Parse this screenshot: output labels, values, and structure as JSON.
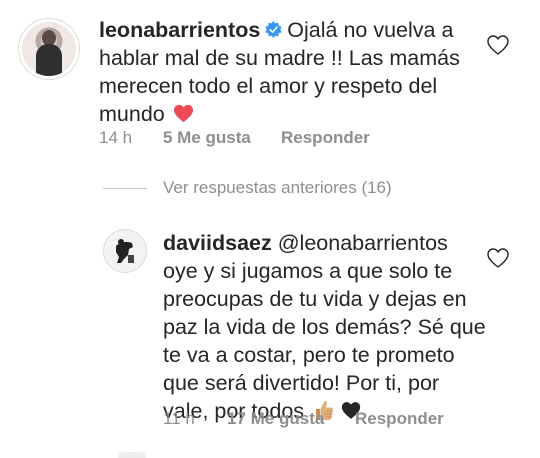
{
  "main_comment": {
    "username": "leonabarrientos",
    "text_line1": "Ojalá no vuelva a",
    "text_line2": "hablar mal de su madre !! Las mamás",
    "text_line3": "merecen todo el amor y respeto del",
    "text_line4": "mundo",
    "emoji": "❤️",
    "time": "14 h",
    "likes": "5 Me gusta",
    "reply_label": "Responder"
  },
  "replies_toggle": {
    "label": "Ver respuestas anteriores (16)"
  },
  "reply_comment": {
    "username": "daviidsaez",
    "mention": "@leonabarrientos",
    "text_line1": "oye y si jugamos a que solo te",
    "text_line2": "preocupas de tu vida y dejas en",
    "text_line3": "paz la vida de los demás? Sé que",
    "text_line4": "te va a costar, pero te prometo",
    "text_line5": "que será divertido! Por ti, por",
    "text_line6": "vale, por todos",
    "emoji_1": "👍🏼",
    "emoji_2": "🖤",
    "time": "11 h",
    "likes": "17 Me gusta",
    "reply_label": "Responder"
  },
  "colors": {
    "text": "#262626",
    "meta": "#8e8e8e",
    "verified_blue": "#3897f0",
    "heart_outline": "#262626",
    "heart_red": "#ed4956",
    "dark_heart": "#262626",
    "thumb": "#e0b07a"
  },
  "icons": {
    "verified": "verified-badge-icon",
    "like_main": "heart-outline-icon",
    "like_reply": "heart-outline-icon"
  }
}
